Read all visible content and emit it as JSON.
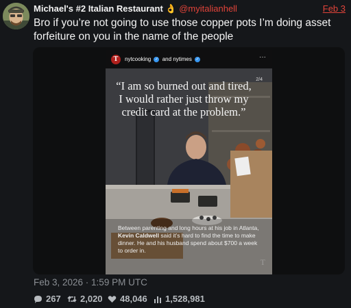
{
  "author": {
    "display_name": "Michael's #2 Italian Restaurant",
    "emoji": "👌",
    "handle": "@myitalianhell"
  },
  "post_date_short": "Feb 3",
  "tweet_text": "Bro if you’re not going to use those copper pots I’m doing asset forfeiture on you in the name of the people",
  "embedded_post": {
    "account_1": "nytcooking",
    "joiner": "and",
    "account_2": "nytimes",
    "more_glyph": "···",
    "logo_glyph": "T",
    "page_indicator": "2/4",
    "quote": "“I am so burned out and tired, I would rather just throw my credit card at the problem.”",
    "caption_before": "Between parenting and long hours at his job in Atlanta, ",
    "caption_name": "Kevin Caldwell",
    "caption_after": " said it’s hard to find the time to make dinner. He and his husband spend about $700 a week to order in.",
    "watermark": "T"
  },
  "timestamp": "Feb 3, 2026 · 1:59 PM UTC",
  "stats": {
    "replies": "267",
    "reposts": "2,020",
    "likes": "48,046",
    "views": "1,528,981"
  },
  "colors": {
    "accent": "#e3443a",
    "background": "#15171a",
    "nyt_red": "#b0201d",
    "verified": "#3897f0"
  }
}
